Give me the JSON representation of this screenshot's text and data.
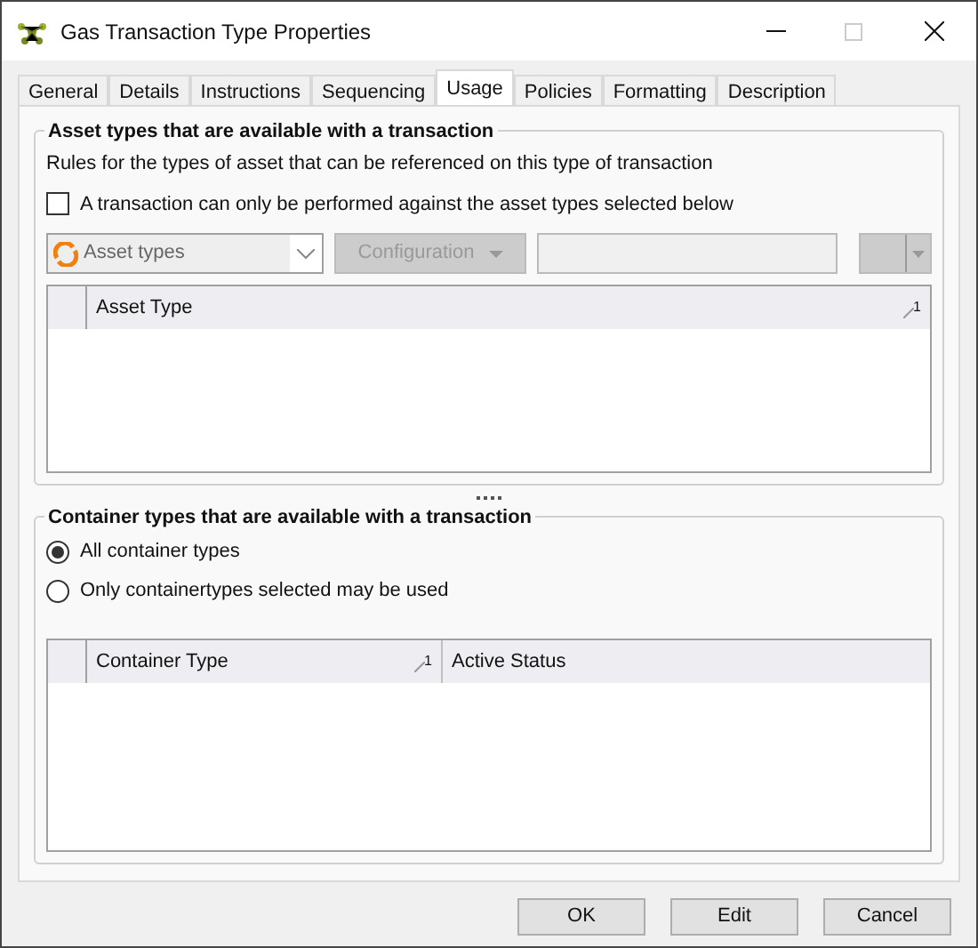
{
  "window": {
    "title": "Gas Transaction Type Properties"
  },
  "tabs": [
    {
      "label": "General",
      "selected": false
    },
    {
      "label": "Details",
      "selected": false
    },
    {
      "label": "Instructions",
      "selected": false
    },
    {
      "label": "Sequencing",
      "selected": false
    },
    {
      "label": "Usage",
      "selected": true
    },
    {
      "label": "Policies",
      "selected": false
    },
    {
      "label": "Formatting",
      "selected": false
    },
    {
      "label": "Description",
      "selected": false
    }
  ],
  "asset_group": {
    "title": "Asset types that are available with a  transaction",
    "description": "Rules for the types of asset that can be referenced on this type of transaction",
    "restrict_checkbox": {
      "label": "A  transaction can only be performed against the asset types selected below",
      "checked": false
    },
    "type_dropdown": {
      "value": "Asset types"
    },
    "configuration_button": {
      "label": "Configuration",
      "disabled": true
    },
    "table": {
      "columns": [
        {
          "label": "Asset Type",
          "sort": "1"
        }
      ]
    }
  },
  "container_group": {
    "title": "Container types that are available with a  transaction",
    "options": [
      {
        "label": "All container types",
        "selected": true
      },
      {
        "label": "Only containertypes selected may be used",
        "selected": false
      }
    ],
    "table": {
      "columns": [
        {
          "label": "Container Type",
          "sort": "1"
        },
        {
          "label": "Active Status"
        }
      ]
    }
  },
  "buttons": [
    "OK",
    "Edit",
    "Cancel"
  ]
}
